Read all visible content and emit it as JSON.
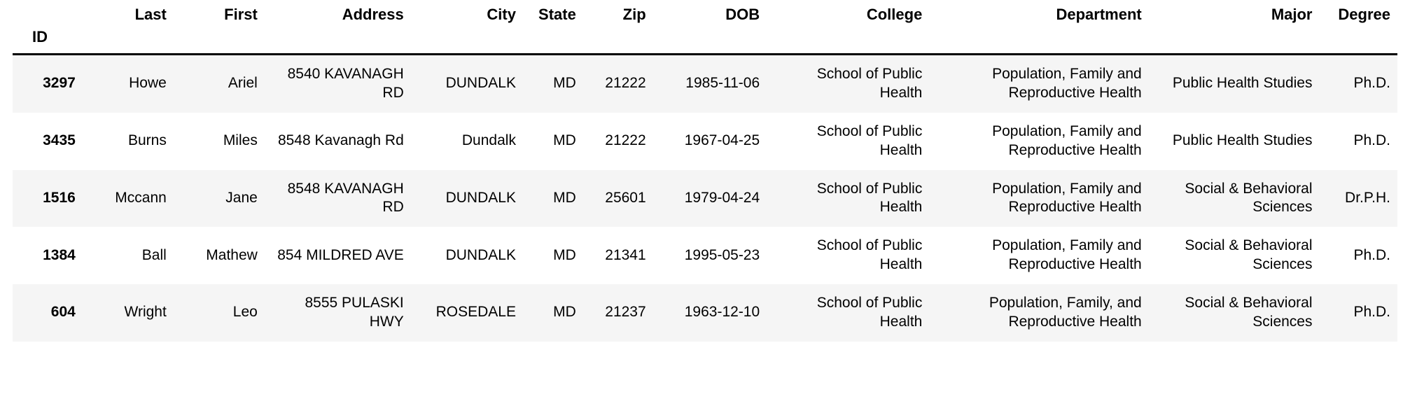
{
  "table": {
    "index_label": "ID",
    "columns": [
      "Last",
      "First",
      "Address",
      "City",
      "State",
      "Zip",
      "DOB",
      "College",
      "Department",
      "Major",
      "Degree"
    ],
    "rows": [
      {
        "id": "3297",
        "last": "Howe",
        "first": "Ariel",
        "address": "8540 KAVANAGH RD",
        "city": "DUNDALK",
        "state": "MD",
        "zip": "21222",
        "dob": "1985-11-06",
        "college": "School of Public Health",
        "department": "Population, Family and Reproductive Health",
        "major": "Public Health Studies",
        "degree": "Ph.D."
      },
      {
        "id": "3435",
        "last": "Burns",
        "first": "Miles",
        "address": "8548 Kavanagh Rd",
        "city": "Dundalk",
        "state": "MD",
        "zip": "21222",
        "dob": "1967-04-25",
        "college": "School of Public Health",
        "department": "Population, Family and Reproductive Health",
        "major": "Public Health Studies",
        "degree": "Ph.D."
      },
      {
        "id": "1516",
        "last": "Mccann",
        "first": "Jane",
        "address": "8548 KAVANAGH RD",
        "city": "DUNDALK",
        "state": "MD",
        "zip": "25601",
        "dob": "1979-04-24",
        "college": "School of Public Health",
        "department": "Population, Family and Reproductive Health",
        "major": "Social & Behavioral Sciences",
        "degree": "Dr.P.H."
      },
      {
        "id": "1384",
        "last": "Ball",
        "first": "Mathew",
        "address": "854 MILDRED AVE",
        "city": "DUNDALK",
        "state": "MD",
        "zip": "21341",
        "dob": "1995-05-23",
        "college": "School of Public Health",
        "department": "Population, Family and Reproductive Health",
        "major": "Social & Behavioral Sciences",
        "degree": "Ph.D."
      },
      {
        "id": "604",
        "last": "Wright",
        "first": "Leo",
        "address": "8555 PULASKI HWY",
        "city": "ROSEDALE",
        "state": "MD",
        "zip": "21237",
        "dob": "1963-12-10",
        "college": "School of Public Health",
        "department": "Population, Family, and Reproductive Health",
        "major": "Social & Behavioral Sciences",
        "degree": "Ph.D."
      }
    ]
  },
  "colors": {
    "stripe": "#f5f5f5",
    "background": "#ffffff",
    "text": "#000000",
    "header_rule": "#000000"
  }
}
